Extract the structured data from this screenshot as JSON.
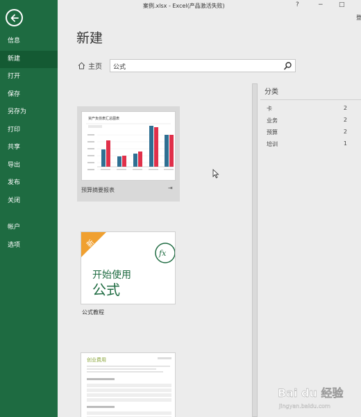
{
  "window": {
    "title": "案例.xlsx - Excel(产品激活失败)",
    "help": "?",
    "minimize": "−",
    "maximize": "□",
    "signin": "登"
  },
  "sidebar": {
    "items": [
      {
        "label": "信息"
      },
      {
        "label": "新建",
        "active": true
      },
      {
        "label": "打开"
      },
      {
        "label": "保存"
      },
      {
        "label": "另存为"
      },
      {
        "label": "打印"
      },
      {
        "label": "共享"
      },
      {
        "label": "导出"
      },
      {
        "label": "发布"
      },
      {
        "label": "关闭"
      }
    ],
    "bottom_items": [
      {
        "label": "帐户"
      },
      {
        "label": "选项"
      }
    ]
  },
  "main": {
    "heading": "新建",
    "home_label": "主页",
    "search": {
      "value": "公式",
      "placeholder": ""
    }
  },
  "templates": [
    {
      "label": "预算摘要报表",
      "thumb_title": "资产负债表汇总图表"
    },
    {
      "label": "公式教程",
      "badge": "新",
      "thumb_line1": "开始使用",
      "thumb_line2": "公式",
      "fx": "fx"
    },
    {
      "label": "",
      "thumb_title": "创业费用"
    }
  ],
  "categories": {
    "title": "分类",
    "items": [
      {
        "name": "卡",
        "count": "2"
      },
      {
        "name": "业务",
        "count": "2"
      },
      {
        "name": "预算",
        "count": "2"
      },
      {
        "name": "培训",
        "count": "1"
      }
    ]
  },
  "watermark": {
    "brand": "Bai du 经验",
    "url": "jingyan.baidu.com"
  },
  "colors": {
    "excel_green": "#1e6b41",
    "excel_green_active": "#145a33",
    "badge_orange": "#f0a030",
    "bar_blue": "#2e6f92",
    "bar_red": "#e0304a"
  }
}
